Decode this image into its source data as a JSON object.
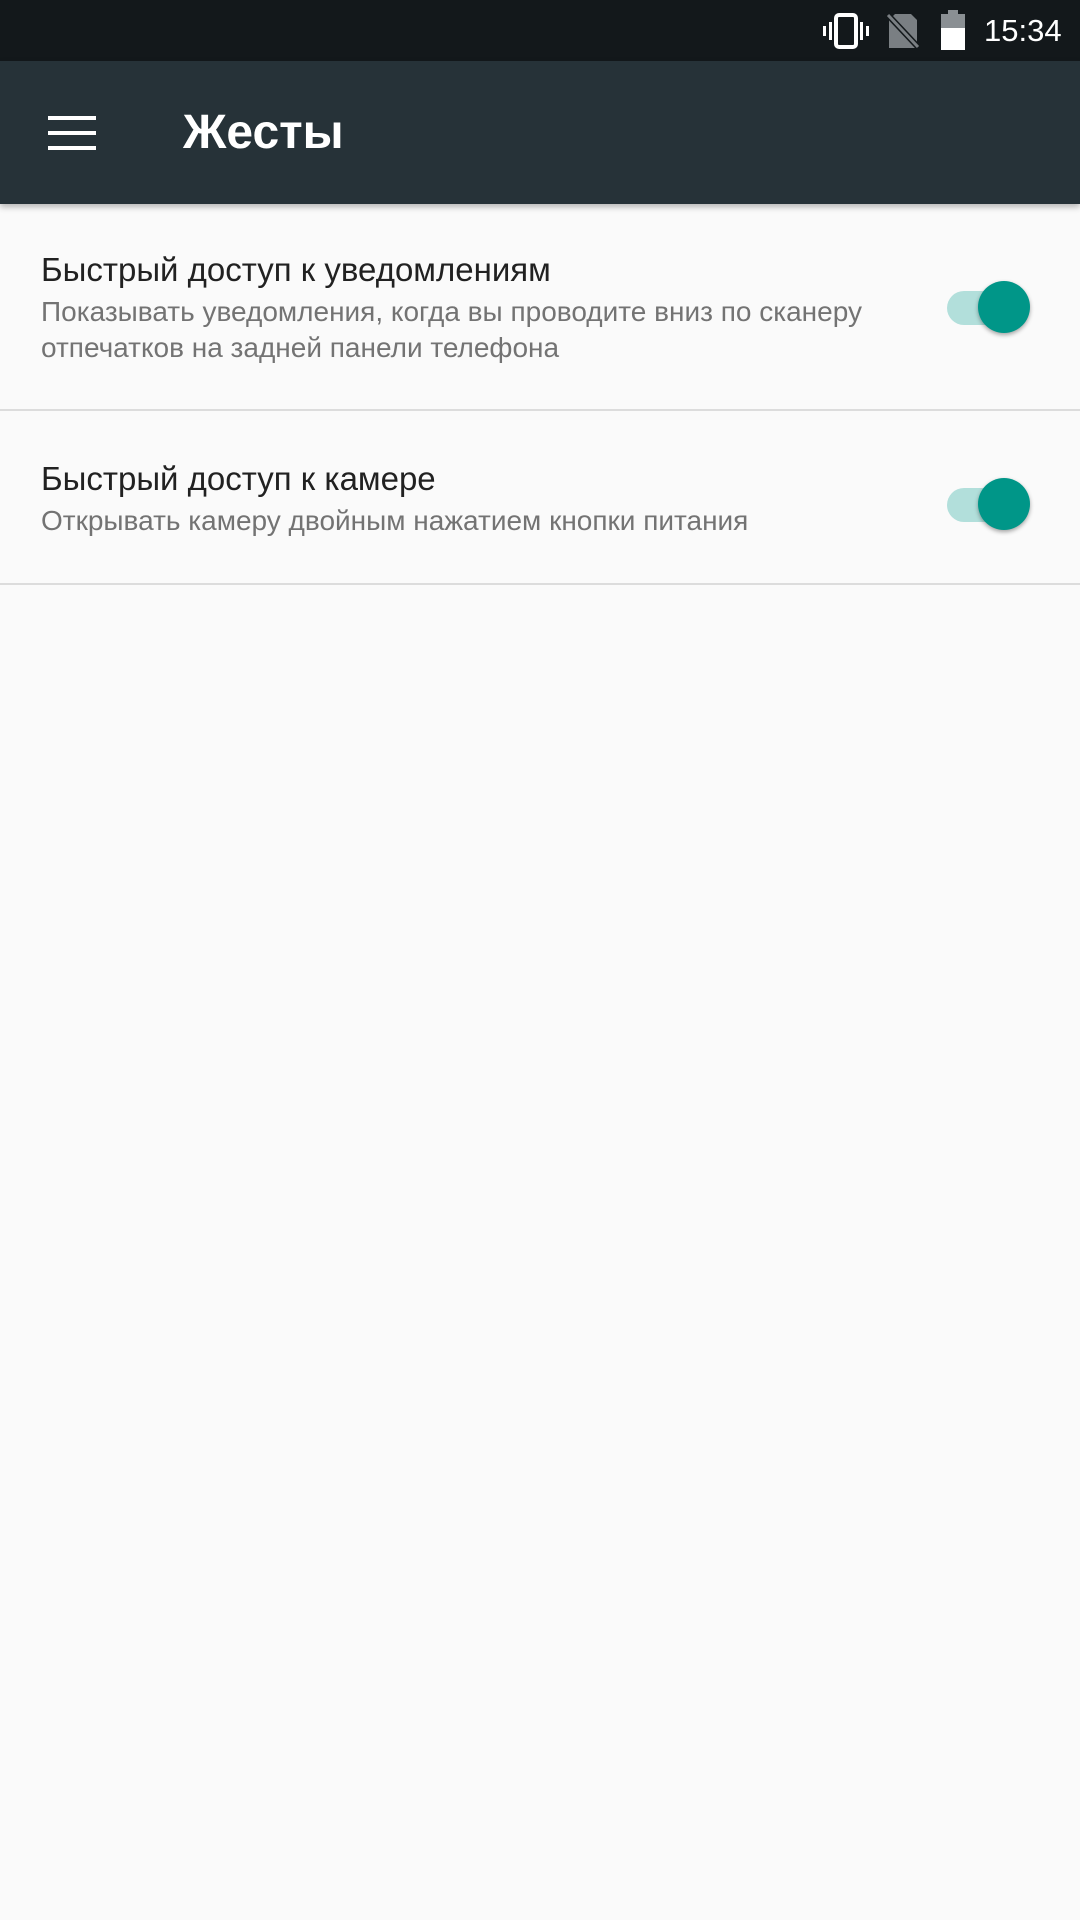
{
  "status_bar": {
    "time": "15:34",
    "icons": [
      "vibrate-icon",
      "no-sim-icon",
      "battery-icon"
    ]
  },
  "app_bar": {
    "title": "Жесты",
    "nav_icon": "menu-icon",
    "background": "#263238"
  },
  "settings": [
    {
      "title": "Быстрый доступ к уведомлениям",
      "summary": "Показывать уведомления, когда вы проводите вниз по сканеру отпечатков на задней панели телефона",
      "enabled": true
    },
    {
      "title": "Быстрый доступ к камере",
      "summary": "Открывать камеру двойным нажатием кнопки питания",
      "enabled": true
    }
  ],
  "colors": {
    "accent": "#009688",
    "switch_track_on": "#b2dfdb",
    "status_bar": "#13181b",
    "background": "#fafafa"
  }
}
